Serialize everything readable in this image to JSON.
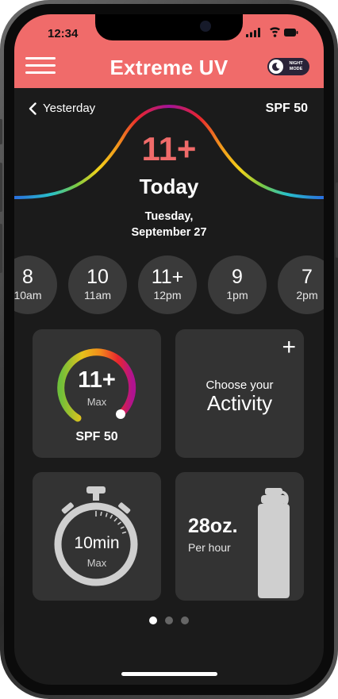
{
  "status_bar": {
    "time": "12:34"
  },
  "header": {
    "title": "Extreme UV",
    "night_mode_label": "NIGHT MODE",
    "brand_color": "#f06b6a"
  },
  "nav": {
    "back_label": "Yesterday",
    "spf": "SPF 50"
  },
  "today": {
    "uv_index": "11+",
    "label": "Today",
    "day": "Tuesday,",
    "date": "September 27"
  },
  "hourly": [
    {
      "value": "8",
      "time": "10am"
    },
    {
      "value": "10",
      "time": "11am"
    },
    {
      "value": "11+",
      "time": "12pm"
    },
    {
      "value": "9",
      "time": "1pm"
    },
    {
      "value": "7",
      "time": "2pm"
    }
  ],
  "cards": {
    "uv_gauge": {
      "value": "11+",
      "sub": "Max",
      "spf": "SPF 50",
      "fill_fraction": 1.0
    },
    "activity": {
      "add_label": "+",
      "prompt": "Choose your",
      "title": "Activity"
    },
    "timer": {
      "value": "10min",
      "sub": "Max"
    },
    "water": {
      "value": "28oz.",
      "unit": "Per hour"
    }
  },
  "pager": {
    "pages": 3,
    "active": 0
  }
}
